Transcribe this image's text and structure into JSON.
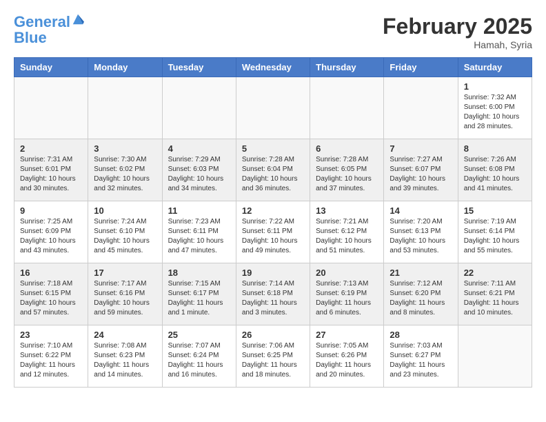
{
  "header": {
    "logo_line1": "General",
    "logo_line2": "Blue",
    "month_title": "February 2025",
    "location": "Hamah, Syria"
  },
  "weekdays": [
    "Sunday",
    "Monday",
    "Tuesday",
    "Wednesday",
    "Thursday",
    "Friday",
    "Saturday"
  ],
  "weeks": [
    [
      {
        "day": "",
        "text": ""
      },
      {
        "day": "",
        "text": ""
      },
      {
        "day": "",
        "text": ""
      },
      {
        "day": "",
        "text": ""
      },
      {
        "day": "",
        "text": ""
      },
      {
        "day": "",
        "text": ""
      },
      {
        "day": "1",
        "text": "Sunrise: 7:32 AM\nSunset: 6:00 PM\nDaylight: 10 hours and 28 minutes."
      }
    ],
    [
      {
        "day": "2",
        "text": "Sunrise: 7:31 AM\nSunset: 6:01 PM\nDaylight: 10 hours and 30 minutes."
      },
      {
        "day": "3",
        "text": "Sunrise: 7:30 AM\nSunset: 6:02 PM\nDaylight: 10 hours and 32 minutes."
      },
      {
        "day": "4",
        "text": "Sunrise: 7:29 AM\nSunset: 6:03 PM\nDaylight: 10 hours and 34 minutes."
      },
      {
        "day": "5",
        "text": "Sunrise: 7:28 AM\nSunset: 6:04 PM\nDaylight: 10 hours and 36 minutes."
      },
      {
        "day": "6",
        "text": "Sunrise: 7:28 AM\nSunset: 6:05 PM\nDaylight: 10 hours and 37 minutes."
      },
      {
        "day": "7",
        "text": "Sunrise: 7:27 AM\nSunset: 6:07 PM\nDaylight: 10 hours and 39 minutes."
      },
      {
        "day": "8",
        "text": "Sunrise: 7:26 AM\nSunset: 6:08 PM\nDaylight: 10 hours and 41 minutes."
      }
    ],
    [
      {
        "day": "9",
        "text": "Sunrise: 7:25 AM\nSunset: 6:09 PM\nDaylight: 10 hours and 43 minutes."
      },
      {
        "day": "10",
        "text": "Sunrise: 7:24 AM\nSunset: 6:10 PM\nDaylight: 10 hours and 45 minutes."
      },
      {
        "day": "11",
        "text": "Sunrise: 7:23 AM\nSunset: 6:11 PM\nDaylight: 10 hours and 47 minutes."
      },
      {
        "day": "12",
        "text": "Sunrise: 7:22 AM\nSunset: 6:11 PM\nDaylight: 10 hours and 49 minutes."
      },
      {
        "day": "13",
        "text": "Sunrise: 7:21 AM\nSunset: 6:12 PM\nDaylight: 10 hours and 51 minutes."
      },
      {
        "day": "14",
        "text": "Sunrise: 7:20 AM\nSunset: 6:13 PM\nDaylight: 10 hours and 53 minutes."
      },
      {
        "day": "15",
        "text": "Sunrise: 7:19 AM\nSunset: 6:14 PM\nDaylight: 10 hours and 55 minutes."
      }
    ],
    [
      {
        "day": "16",
        "text": "Sunrise: 7:18 AM\nSunset: 6:15 PM\nDaylight: 10 hours and 57 minutes."
      },
      {
        "day": "17",
        "text": "Sunrise: 7:17 AM\nSunset: 6:16 PM\nDaylight: 10 hours and 59 minutes."
      },
      {
        "day": "18",
        "text": "Sunrise: 7:15 AM\nSunset: 6:17 PM\nDaylight: 11 hours and 1 minute."
      },
      {
        "day": "19",
        "text": "Sunrise: 7:14 AM\nSunset: 6:18 PM\nDaylight: 11 hours and 3 minutes."
      },
      {
        "day": "20",
        "text": "Sunrise: 7:13 AM\nSunset: 6:19 PM\nDaylight: 11 hours and 6 minutes."
      },
      {
        "day": "21",
        "text": "Sunrise: 7:12 AM\nSunset: 6:20 PM\nDaylight: 11 hours and 8 minutes."
      },
      {
        "day": "22",
        "text": "Sunrise: 7:11 AM\nSunset: 6:21 PM\nDaylight: 11 hours and 10 minutes."
      }
    ],
    [
      {
        "day": "23",
        "text": "Sunrise: 7:10 AM\nSunset: 6:22 PM\nDaylight: 11 hours and 12 minutes."
      },
      {
        "day": "24",
        "text": "Sunrise: 7:08 AM\nSunset: 6:23 PM\nDaylight: 11 hours and 14 minutes."
      },
      {
        "day": "25",
        "text": "Sunrise: 7:07 AM\nSunset: 6:24 PM\nDaylight: 11 hours and 16 minutes."
      },
      {
        "day": "26",
        "text": "Sunrise: 7:06 AM\nSunset: 6:25 PM\nDaylight: 11 hours and 18 minutes."
      },
      {
        "day": "27",
        "text": "Sunrise: 7:05 AM\nSunset: 6:26 PM\nDaylight: 11 hours and 20 minutes."
      },
      {
        "day": "28",
        "text": "Sunrise: 7:03 AM\nSunset: 6:27 PM\nDaylight: 11 hours and 23 minutes."
      },
      {
        "day": "",
        "text": ""
      }
    ]
  ]
}
